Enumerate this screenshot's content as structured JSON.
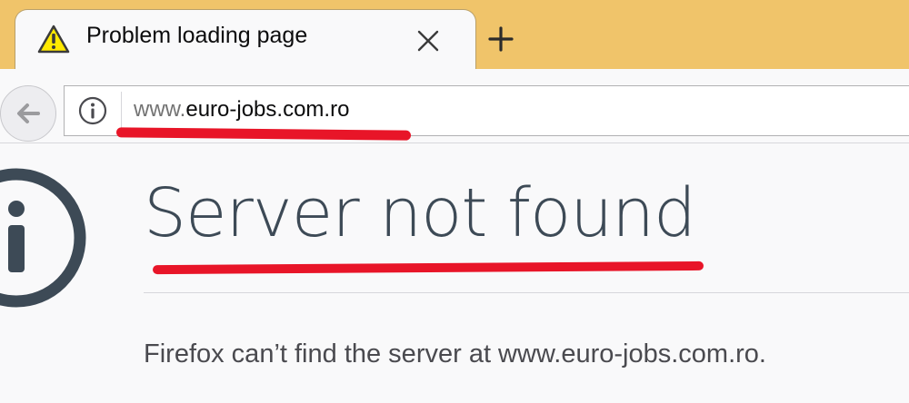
{
  "tab": {
    "title": "Problem loading page",
    "icon": "warning-icon",
    "close_icon": "close-icon"
  },
  "new_tab": {
    "icon": "plus-icon"
  },
  "navbar": {
    "back_icon": "back-arrow-icon",
    "identity_icon": "info-circle-icon",
    "url_prefix": "www.",
    "url_domain": "euro-jobs.com.ro"
  },
  "error": {
    "icon": "info-icon",
    "title": "Server not found",
    "description": "Firefox can’t find the server at www.euro-jobs.com.ro."
  },
  "colors": {
    "tabstrip": "#f0c46a",
    "annotation": "#e81528",
    "title_text": "#3d4a56"
  }
}
